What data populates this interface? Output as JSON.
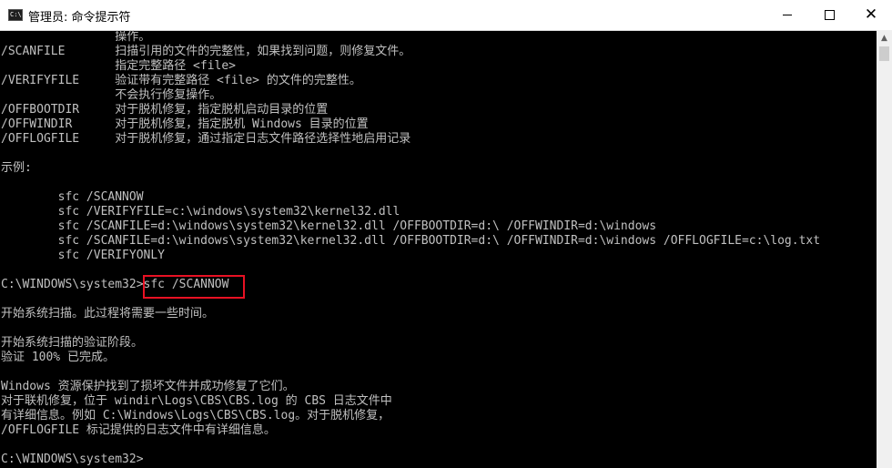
{
  "window": {
    "title": "管理员: 命令提示符",
    "icon": "cmd-icon",
    "icon_text": "C:\\",
    "controls": {
      "minimize": "minimize-icon",
      "maximize": "maximize-icon",
      "close": "close-icon"
    }
  },
  "console": {
    "lines": [
      "                操作。",
      "/SCANFILE       扫描引用的文件的完整性，如果找到问题，则修复文件。",
      "                指定完整路径 <file>",
      "/VERIFYFILE     验证带有完整路径 <file> 的文件的完整性。",
      "                不会执行修复操作。",
      "/OFFBOOTDIR     对于脱机修复，指定脱机启动目录的位置",
      "/OFFWINDIR      对于脱机修复，指定脱机 Windows 目录的位置",
      "/OFFLOGFILE     对于脱机修复，通过指定日志文件路径选择性地启用记录",
      "",
      "示例:",
      "",
      "        sfc /SCANNOW",
      "        sfc /VERIFYFILE=c:\\windows\\system32\\kernel32.dll",
      "        sfc /SCANFILE=d:\\windows\\system32\\kernel32.dll /OFFBOOTDIR=d:\\ /OFFWINDIR=d:\\windows",
      "        sfc /SCANFILE=d:\\windows\\system32\\kernel32.dll /OFFBOOTDIR=d:\\ /OFFWINDIR=d:\\windows /OFFLOGFILE=c:\\log.txt",
      "        sfc /VERIFYONLY",
      "",
      "C:\\WINDOWS\\system32>sfc /SCANNOW",
      "",
      "开始系统扫描。此过程将需要一些时间。",
      "",
      "开始系统扫描的验证阶段。",
      "验证 100% 已完成。",
      "",
      "Windows 资源保护找到了损坏文件并成功修复了它们。",
      "对于联机修复，位于 windir\\Logs\\CBS\\CBS.log 的 CBS 日志文件中",
      "有详细信息。例如 C:\\Windows\\Logs\\CBS\\CBS.log。对于脱机修复，",
      "/OFFLOGFILE 标记提供的日志文件中有详细信息。",
      "",
      "C:\\WINDOWS\\system32>"
    ]
  },
  "colors": {
    "console_background": "#000000",
    "console_text": "#c0c0c0",
    "highlight_border": "#e81123",
    "titlebar": "#ffffff"
  }
}
